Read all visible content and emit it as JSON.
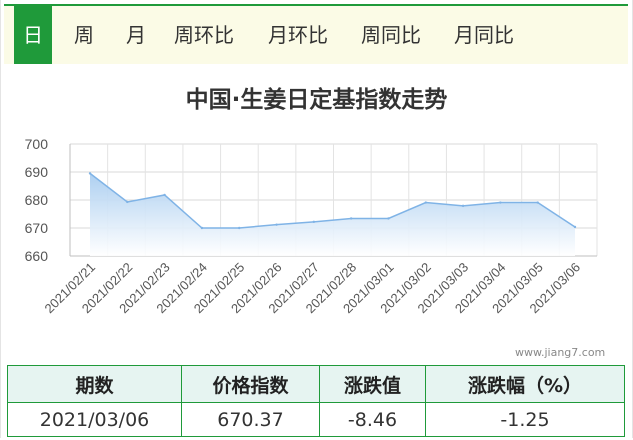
{
  "tabs": [
    "日",
    "周",
    "月",
    "周环比",
    "月环比",
    "周同比",
    "月同比"
  ],
  "active_tab": 0,
  "watermark": "www.jiang7.com",
  "colors": {
    "accent": "#1f9a3a",
    "line": "#7fb3e6",
    "area_top": "#a9cdf0",
    "area_bottom": "#ffffff",
    "header_bg": "#e6f4f1"
  },
  "chart_data": {
    "type": "area",
    "title": "中国·生姜日定基指数走势",
    "x": [
      "2021/02/21",
      "2021/02/22",
      "2021/02/23",
      "2021/02/24",
      "2021/02/25",
      "2021/02/26",
      "2021/02/27",
      "2021/02/28",
      "2021/03/01",
      "2021/03/02",
      "2021/03/03",
      "2021/03/04",
      "2021/03/05",
      "2021/03/06"
    ],
    "values": [
      689.5,
      679.3,
      681.8,
      670.0,
      670.0,
      671.2,
      672.2,
      673.4,
      673.4,
      679.1,
      677.9,
      679.1,
      679.1,
      670.37
    ],
    "ylim": [
      660,
      700
    ],
    "yticks": [
      "660",
      "670",
      "680",
      "690",
      "700"
    ],
    "grid": true
  },
  "table": {
    "headers": [
      "期数",
      "价格指数",
      "涨跌值",
      "涨跌幅（%）"
    ],
    "row": [
      "2021/03/06",
      "670.37",
      "-8.46",
      "-1.25"
    ]
  }
}
